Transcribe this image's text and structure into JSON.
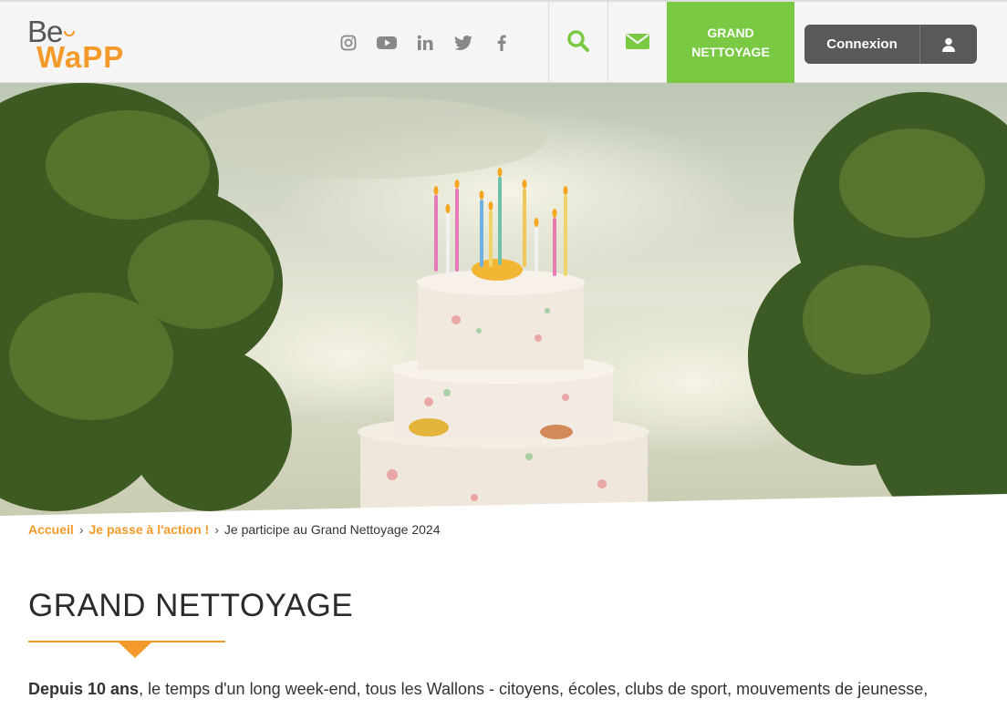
{
  "header": {
    "logo": {
      "line1": "Be",
      "line2": "WaPP"
    },
    "social": [
      {
        "name": "instagram",
        "icon": "instagram-icon"
      },
      {
        "name": "youtube",
        "icon": "youtube-icon"
      },
      {
        "name": "linkedin",
        "icon": "linkedin-icon"
      },
      {
        "name": "twitter",
        "icon": "twitter-icon"
      },
      {
        "name": "facebook",
        "icon": "facebook-icon"
      }
    ],
    "grand_btn": {
      "line1": "GRAND",
      "line2": "NETTOYAGE"
    },
    "login_label": "Connexion",
    "colors": {
      "accent_green": "#7ac943",
      "accent_orange": "#f39a2a",
      "dark_button": "#595959"
    }
  },
  "breadcrumb": {
    "home": "Accueil",
    "parent": "Je passe à l'action !",
    "sep": "›",
    "current": "Je participe au Grand Nettoyage 2024"
  },
  "main": {
    "title": "GRAND NETTOYAGE",
    "intro_bold": "Depuis 10 ans",
    "intro_rest": ", le temps d'un long week-end, tous les Wallons - citoyens, écoles, clubs de sport, mouvements de jeunesse,"
  }
}
